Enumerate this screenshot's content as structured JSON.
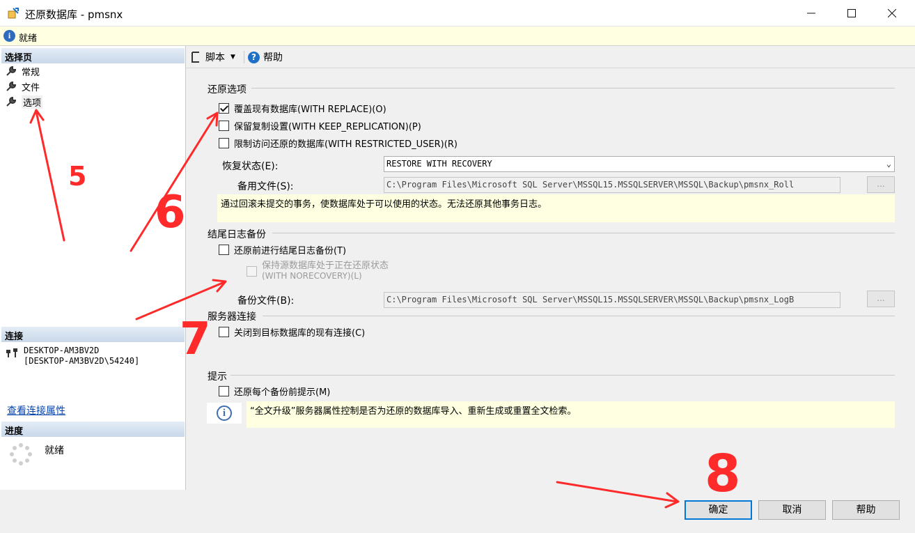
{
  "window": {
    "title": "还原数据库 - pmsnx"
  },
  "status": {
    "text": "就绪"
  },
  "left": {
    "select_page_header": "选择页",
    "pages": [
      {
        "label": "常规"
      },
      {
        "label": "文件"
      },
      {
        "label": "选项"
      }
    ],
    "connection_header": "连接",
    "connection_server": "DESKTOP-AM3BV2D",
    "connection_user": "[DESKTOP-AM3BV2D\\54240]",
    "connection_link": "查看连接属性",
    "progress_header": "进度",
    "progress_text": "就绪"
  },
  "toolbar": {
    "script_label": "脚本",
    "help_label": "帮助"
  },
  "restore_options": {
    "group_label": "还原选项",
    "overwrite": {
      "label": "覆盖现有数据库(WITH REPLACE)(O)",
      "checked": true
    },
    "keep_replication": {
      "label": "保留复制设置(WITH KEEP_REPLICATION)(P)",
      "checked": false
    },
    "restricted_user": {
      "label": "限制访问还原的数据库(WITH RESTRICTED_USER)(R)",
      "checked": false
    },
    "recovery_state_label": "恢复状态(E):",
    "recovery_state_value": "RESTORE WITH RECOVERY",
    "standby_file_label": "备用文件(S):",
    "standby_file_value": "C:\\Program Files\\Microsoft SQL Server\\MSSQL15.MSSQLSERVER\\MSSQL\\Backup\\pmsnx_Roll",
    "browse_label": "...",
    "description": "通过回滚未提交的事务，使数据库处于可以使用的状态。无法还原其他事务日志。"
  },
  "tail_log": {
    "group_label": "结尾日志备份",
    "take_tail_log": {
      "label": "还原前进行结尾日志备份(T)",
      "checked": false
    },
    "leave_restoring_line1": "保持源数据库处于正在还原状态",
    "leave_restoring_line2": "(WITH NORECOVERY)(L)",
    "backup_file_label": "备份文件(B):",
    "backup_file_value": "C:\\Program Files\\Microsoft SQL Server\\MSSQL15.MSSQLSERVER\\MSSQL\\Backup\\pmsnx_LogB",
    "browse_label": "..."
  },
  "server_connections": {
    "group_label": "服务器连接",
    "close_connections": {
      "label": "关闭到目标数据库的现有连接(C)",
      "checked": false
    }
  },
  "prompt": {
    "group_label": "提示",
    "prompt_before_each": {
      "label": "还原每个备份前提示(M)",
      "checked": false
    },
    "info_text": "“全文升级”服务器属性控制是否为还原的数据库导入、重新生成或重置全文检索。"
  },
  "buttons": {
    "ok": "确定",
    "cancel": "取消",
    "help": "帮助"
  },
  "annotations": {
    "five": "5",
    "six": "6",
    "seven": "7",
    "eight": "8",
    "stroke_color": "#ff2a2a"
  },
  "colors": {
    "accent": "#0078d7",
    "info_bg": "#ffffe1",
    "link": "#0645ad"
  }
}
